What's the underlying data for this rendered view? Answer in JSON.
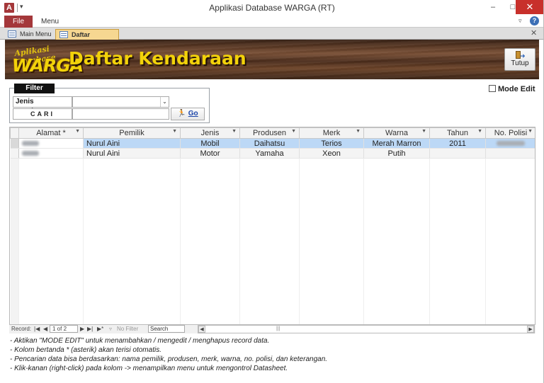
{
  "window": {
    "app_icon": "A",
    "title": "Applikasi Database WARGA (RT)",
    "min_icon": "minimize-icon",
    "max_icon": "maximize-icon",
    "close_icon": "close-icon"
  },
  "ribbon": {
    "file_label": "File",
    "menu_label": "Menu"
  },
  "doc_tabs": [
    {
      "label": "Main Menu",
      "active": false
    },
    {
      "label": "Daftar Kendaraan",
      "active": true
    }
  ],
  "banner": {
    "logo_top": "Aplikasi Database",
    "logo_main": "WARGA",
    "title": "Daftar Kendaraan",
    "close_button_label": "Tutup"
  },
  "filter": {
    "section_label": "Filter",
    "jenis_label": "Jenis Kendaraan",
    "jenis_value": "",
    "cari_label": "CARI",
    "cari_value": "",
    "go_label": "Go"
  },
  "mode_edit": {
    "label": "Mode Edit",
    "checked": false
  },
  "datasheet": {
    "columns": [
      "Alamat *",
      "Pemilik",
      "Jenis",
      "Produsen",
      "Merk",
      "Warna",
      "Tahun",
      "No. Polisi"
    ],
    "rows": [
      {
        "alamat": "",
        "pemilik": "Nurul Aini",
        "jenis": "Mobil",
        "produsen": "Daihatsu",
        "merk": "Terios",
        "warna": "Merah Marron",
        "tahun": "2011",
        "no_polisi": ""
      },
      {
        "alamat": "",
        "pemilik": "Nurul Aini",
        "jenis": "Motor",
        "produsen": "Yamaha",
        "merk": "Xeon",
        "warna": "Putih",
        "tahun": "",
        "no_polisi": ""
      }
    ]
  },
  "navbar": {
    "record_label": "Record:",
    "record_position": "1 of 2",
    "no_filter_label": "No Filter",
    "search_label": "Search"
  },
  "notes": [
    "- Aktikan \"MODE EDIT\" untuk menambahkan / mengedit / menghapus record data.",
    "- Kolom bertanda * (asterik) akan terisi otomatis.",
    "- Pencarian data bisa berdasarkan: nama pemilik, produsen, merk, warna, no. polisi, dan keterangan.",
    "- Klik-kanan (right-click) pada kolom -> menampilkan menu untuk mengontrol Datasheet."
  ],
  "colors": {
    "accent": "#a4373a",
    "banner_text": "#f2d20a",
    "selected_row": "#bcd8f6",
    "active_tab": "#f6d791"
  }
}
